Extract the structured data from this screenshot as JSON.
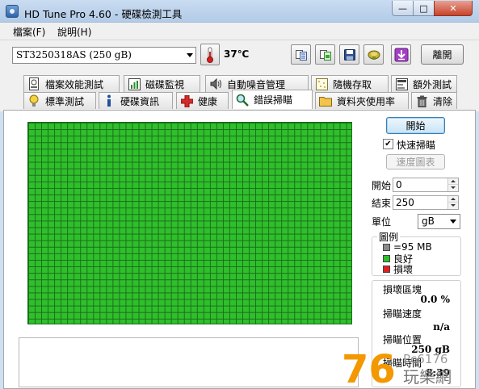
{
  "window": {
    "title": "HD Tune Pro 4.60 - 硬碟檢測工具",
    "minimize_glyph": "—",
    "maximize_glyph": "□",
    "close_glyph": "✕"
  },
  "menu": [
    "檔案(F)",
    "說明(H)"
  ],
  "toolbar": {
    "drive": "ST3250318AS (250 gB)",
    "temperature": "37℃",
    "exit_label": "離開",
    "icons": [
      "copy-text-icon",
      "copy-screenshot-icon",
      "save-icon",
      "options-icon",
      "download-icon"
    ]
  },
  "tabs_back": [
    "檔案效能測試",
    "磁碟監視",
    "自動噪音管理",
    "隨機存取",
    "額外測試"
  ],
  "tabs_front": [
    "標準測試",
    "硬碟資訊",
    "健康",
    "錯誤掃瞄",
    "資料夾使用率",
    "清除"
  ],
  "active_tab": "錯誤掃瞄",
  "scan": {
    "start_button": "開始",
    "quick_scan_label": "快速掃瞄",
    "quick_scan_checked": true,
    "speed_map_button": "速度圖表",
    "start_label": "開始",
    "start_value": "0",
    "end_label": "結束",
    "end_value": "250",
    "unit_label": "單位",
    "unit_value": "gB",
    "legend_title": "圖例",
    "legend": [
      {
        "label": "=95 MB",
        "color": "#8a8a8a"
      },
      {
        "label": "良好",
        "color": "#2fbf2c"
      },
      {
        "label": "損壞",
        "color": "#e02020"
      }
    ],
    "damaged_blocks_label": "損壞區塊",
    "damaged_blocks_value": "0.0 %",
    "scan_speed_label": "掃瞄速度",
    "scan_speed_value": "n/a",
    "scan_position_label": "掃瞄位置",
    "scan_position_value": "250 gB",
    "scan_time_label": "掃瞄時間",
    "scan_time_value": "8:39"
  },
  "watermark": {
    "number": "76",
    "site": "Pc6176",
    "chars": "玩樂網"
  }
}
